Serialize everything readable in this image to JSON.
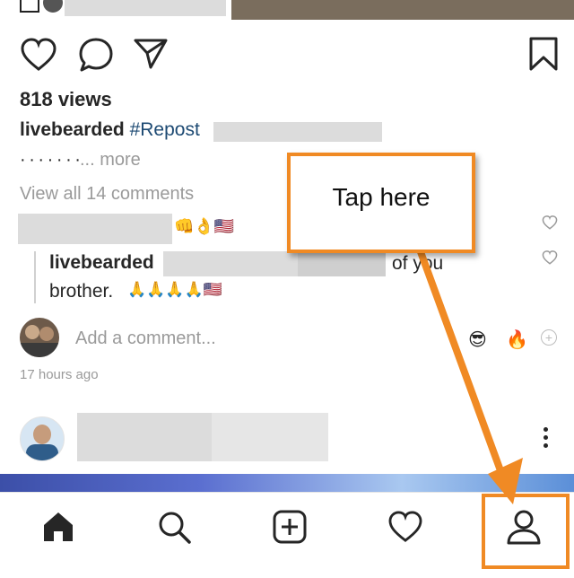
{
  "post": {
    "views": "818 views",
    "caption_user": "livebearded",
    "caption_tag": "#Repost",
    "caption_more_dots": "· · · · · · ·",
    "caption_more": "... more",
    "view_comments": "View all 14 comments"
  },
  "comments": [
    {
      "emojis": "👊👌🇺🇸"
    },
    {
      "user": "livebearded",
      "tail": "of you",
      "line2": "brother.",
      "emojis": "🙏🙏🙏🙏🇺🇸"
    }
  ],
  "add_comment": {
    "placeholder": "Add a comment...",
    "quick_emojis": [
      "😎",
      "🔥"
    ]
  },
  "timestamp": "17 hours ago",
  "annotation": {
    "callout_text": "Tap here",
    "color": "#f08a24"
  },
  "nav": {
    "items": [
      "home-icon",
      "search-icon",
      "add-post-icon",
      "activity-heart-icon",
      "profile-icon"
    ]
  }
}
